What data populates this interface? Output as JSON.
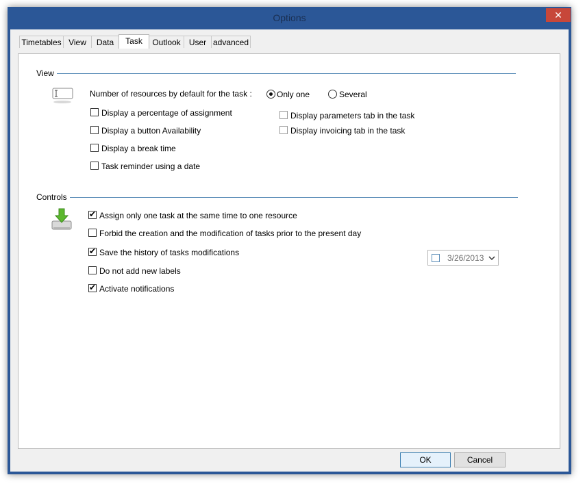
{
  "window": {
    "title": "Options",
    "close_glyph": "✕"
  },
  "tabs": [
    {
      "label": "Timetables"
    },
    {
      "label": "View"
    },
    {
      "label": "Data"
    },
    {
      "label": "Task"
    },
    {
      "label": "Outlook"
    },
    {
      "label": "User"
    },
    {
      "label": "advanced"
    }
  ],
  "active_tab": "Task",
  "view_group": {
    "label": "View",
    "resources_label": "Number of resources by default for the task :",
    "radio_only_one": {
      "label": "Only one",
      "checked": true
    },
    "radio_several": {
      "label": "Several",
      "checked": false
    },
    "left_options": [
      {
        "label": "Display a percentage of assignment",
        "checked": false
      },
      {
        "label": "Display a button Availability",
        "checked": false
      },
      {
        "label": "Display a break time",
        "checked": false
      },
      {
        "label": "Task reminder using a date",
        "checked": false
      }
    ],
    "right_options": [
      {
        "label": "Display parameters tab in the task",
        "checked": false
      },
      {
        "label": "Display invoicing tab in the task",
        "checked": false
      }
    ]
  },
  "controls_group": {
    "label": "Controls",
    "options": [
      {
        "label": "Assign only one task at the same time to one resource",
        "checked": true
      },
      {
        "label": "Forbid the creation and the modification of tasks prior to the present day",
        "checked": false
      },
      {
        "label": "Save the history of tasks modifications",
        "checked": true
      },
      {
        "label": "Do not add new labels",
        "checked": false
      },
      {
        "label": "Activate notifications",
        "checked": true
      }
    ],
    "date_value": "3/26/2013",
    "date_checked": false
  },
  "buttons": {
    "ok": "OK",
    "cancel": "Cancel"
  },
  "colors": {
    "window_border": "#2b5797",
    "close_button": "#c7473a",
    "group_line": "#5b8db8",
    "icon_green": "#5cb82e"
  },
  "icons": {
    "view_icon": "textbox-icon",
    "controls_icon": "download-drive-icon",
    "date_dropdown": "chevron-down-icon"
  }
}
